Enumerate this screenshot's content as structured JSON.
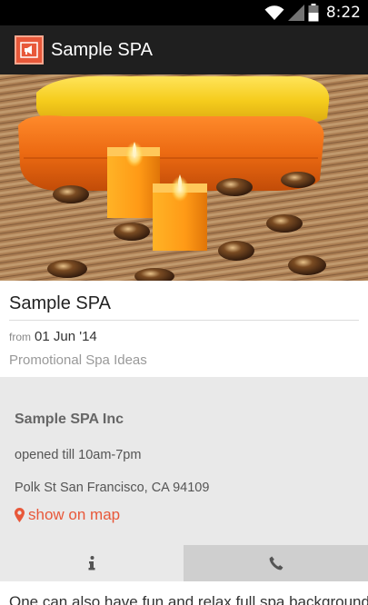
{
  "status_bar": {
    "time": "8:22",
    "icons": [
      "wifi-icon",
      "signal-icon",
      "battery-icon"
    ]
  },
  "app_bar": {
    "title": "Sample SPA",
    "icon": "megaphone-icon",
    "accent_color": "#e8583a"
  },
  "hero": {
    "icon": "spa-photo"
  },
  "listing": {
    "title": "Sample SPA",
    "date_prefix": "from",
    "date": "01 Jun '14",
    "category": "Promotional Spa Ideas"
  },
  "business": {
    "name": "Sample SPA Inc",
    "hours": "opened till 10am-7pm",
    "address": "Polk St San Francisco, CA 94109",
    "map_link": "show on map",
    "map_icon": "map-marker-icon"
  },
  "tabs": [
    {
      "icon": "info-icon",
      "selected": true
    },
    {
      "icon": "phone-icon",
      "selected": false
    }
  ],
  "description_preview": "One can also have fun and relax full spa background."
}
